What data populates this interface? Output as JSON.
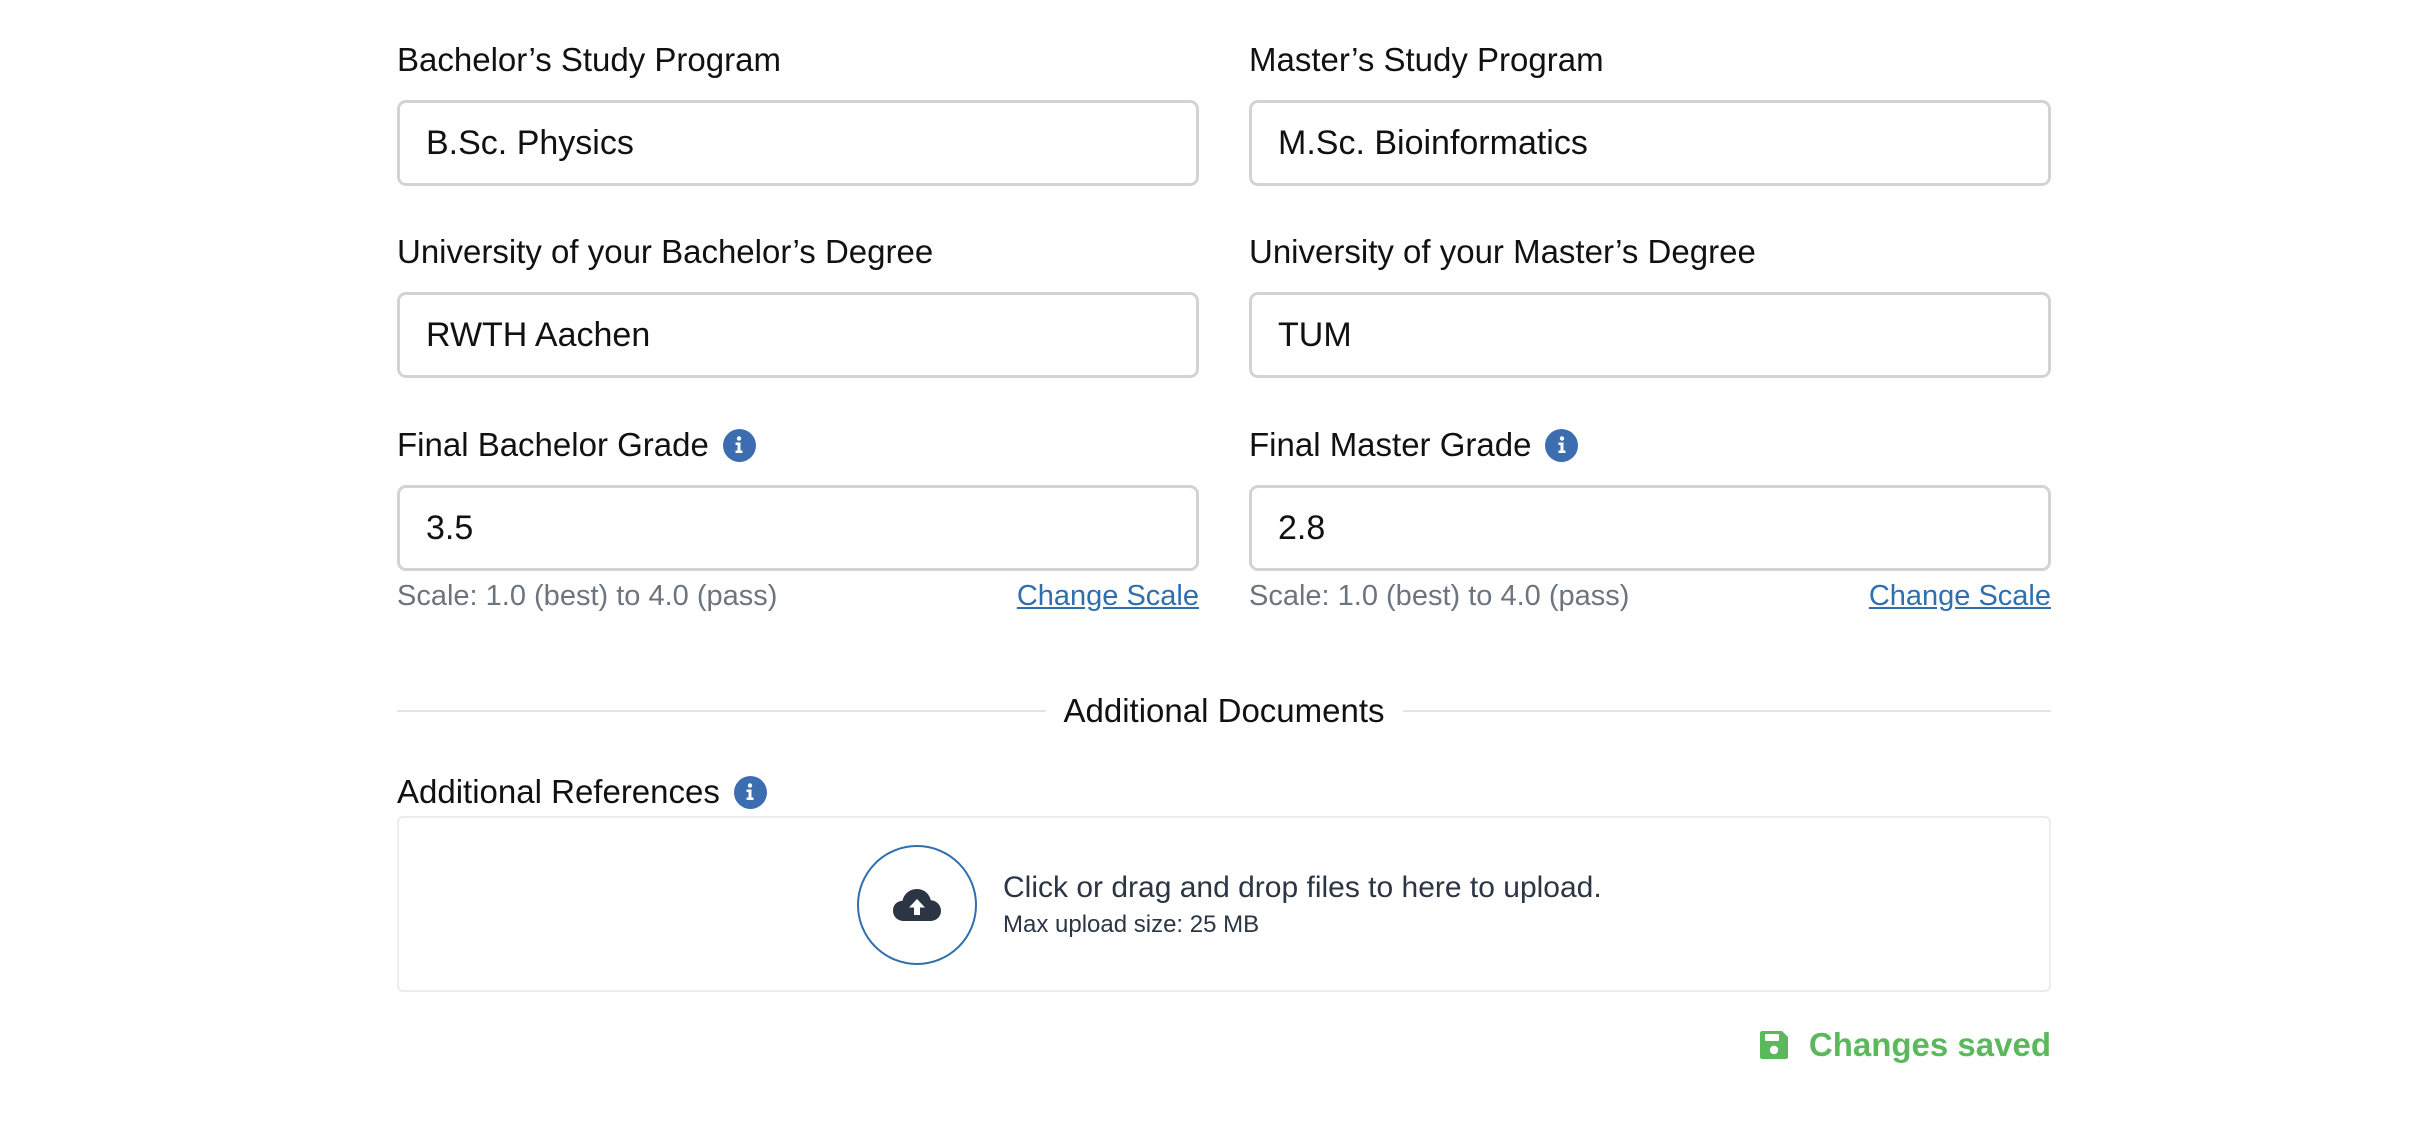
{
  "bachelor_program": {
    "label": "Bachelor’s Study Program",
    "value": "B.Sc. Physics"
  },
  "master_program": {
    "label": "Master’s Study Program",
    "value": "M.Sc. Bioinformatics"
  },
  "bachelor_university": {
    "label": "University of your Bachelor’s Degree",
    "value": "RWTH Aachen"
  },
  "master_university": {
    "label": "University of your Master’s Degree",
    "value": "TUM"
  },
  "bachelor_grade": {
    "label": "Final Bachelor Grade",
    "value": "3.5",
    "scale_text": "Scale: 1.0 (best) to 4.0 (pass)",
    "change_scale": "Change Scale",
    "icon": "info-icon"
  },
  "master_grade": {
    "label": "Final Master Grade",
    "value": "2.8",
    "scale_text": "Scale: 1.0 (best) to 4.0 (pass)",
    "change_scale": "Change Scale",
    "icon": "info-icon"
  },
  "section": {
    "title": "Additional Documents"
  },
  "additional_references": {
    "label": "Additional References",
    "icon": "info-icon",
    "upload_text": "Click or drag and drop files to here to upload.",
    "max_size_text": "Max upload size: 25 MB",
    "upload_icon": "cloud-upload-icon"
  },
  "status": {
    "text": "Changes saved",
    "icon": "save-icon",
    "color": "#5cb85c"
  },
  "colors": {
    "accent": "#3b6db0",
    "link": "#2f6fae",
    "muted_text": "#6c757d",
    "success": "#5cb85c"
  }
}
